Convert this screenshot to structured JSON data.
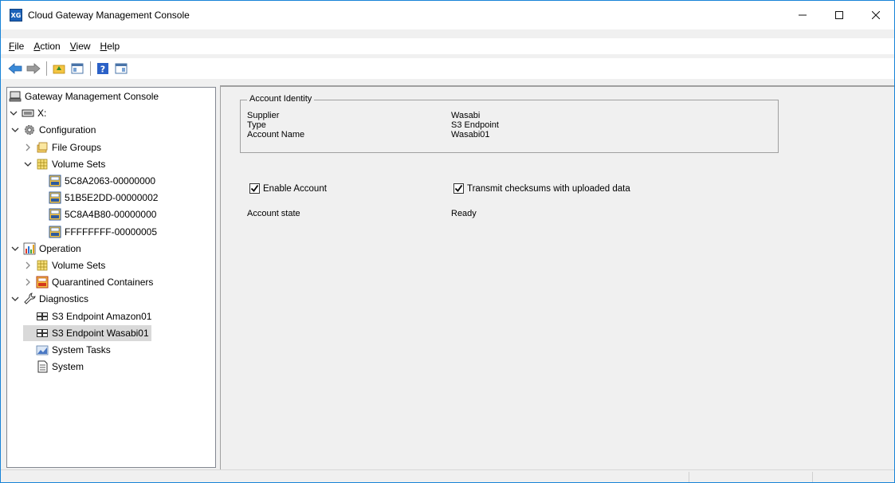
{
  "window": {
    "title": "Cloud Gateway Management Console",
    "app_icon_text": "XG",
    "controls": {
      "minimize": "—",
      "maximize": "☐",
      "close": "✕"
    }
  },
  "menu": [
    {
      "label": "File",
      "accel": "F",
      "rest": "ile"
    },
    {
      "label": "Action",
      "accel": "A",
      "rest": "ction"
    },
    {
      "label": "View",
      "accel": "V",
      "rest": "iew"
    },
    {
      "label": "Help",
      "accel": "H",
      "rest": "elp"
    }
  ],
  "toolbar": {
    "buttons": [
      "back-arrow-icon",
      "forward-arrow-icon",
      "up-folder-icon",
      "show-hide-tree-icon",
      "help-icon",
      "action-pane-icon"
    ]
  },
  "tree": {
    "items": [
      {
        "label": "Gateway Management Console",
        "icon": "console-icon",
        "level": 0,
        "expander": ""
      },
      {
        "label": "X:",
        "icon": "drive-icon",
        "level": 0,
        "expander": "down"
      },
      {
        "label": "Configuration",
        "icon": "gear-icon",
        "level": 1,
        "expander": "down"
      },
      {
        "label": "File Groups",
        "icon": "file-groups-icon",
        "level": 2,
        "expander": "right"
      },
      {
        "label": "Volume Sets",
        "icon": "volume-sets-icon",
        "level": 2,
        "expander": "down"
      },
      {
        "label": "5C8A2063-00000000",
        "icon": "volume-icon",
        "level": 3,
        "expander": ""
      },
      {
        "label": "51B5E2DD-00000002",
        "icon": "volume-icon",
        "level": 3,
        "expander": ""
      },
      {
        "label": "5C8A4B80-00000000",
        "icon": "volume-icon",
        "level": 3,
        "expander": ""
      },
      {
        "label": "FFFFFFFF-00000005",
        "icon": "volume-icon",
        "level": 3,
        "expander": ""
      },
      {
        "label": "Operation",
        "icon": "operation-chart-icon",
        "level": 1,
        "expander": "down"
      },
      {
        "label": "Volume Sets",
        "icon": "volume-sets-icon",
        "level": 2,
        "expander": "right"
      },
      {
        "label": "Quarantined Containers",
        "icon": "quarantined-icon",
        "level": 2,
        "expander": "right"
      },
      {
        "label": "Diagnostics",
        "icon": "wrench-icon",
        "level": 1,
        "expander": "down"
      },
      {
        "label": "S3 Endpoint Amazon01",
        "icon": "endpoint-icon",
        "level": 2,
        "expander": ""
      },
      {
        "label": "S3 Endpoint Wasabi01",
        "icon": "endpoint-icon",
        "level": 2,
        "expander": "",
        "selected": true
      },
      {
        "label": "System Tasks",
        "icon": "tasks-icon",
        "level": 2,
        "expander": ""
      },
      {
        "label": "System",
        "icon": "document-icon",
        "level": 2,
        "expander": ""
      }
    ]
  },
  "account_identity": {
    "legend": "Account Identity",
    "rows": [
      {
        "label": "Supplier",
        "value": "Wasabi"
      },
      {
        "label": "Type",
        "value": "S3 Endpoint"
      },
      {
        "label": "Account Name",
        "value": "Wasabi01"
      }
    ]
  },
  "options": {
    "enable_account": {
      "label": "Enable Account",
      "checked": true
    },
    "transmit_checksums": {
      "label": "Transmit checksums with uploaded data",
      "checked": true
    }
  },
  "state": {
    "label": "Account state",
    "value": "Ready"
  },
  "colors": {
    "accent": "#1883d7",
    "selection": "#d9d9d9"
  }
}
